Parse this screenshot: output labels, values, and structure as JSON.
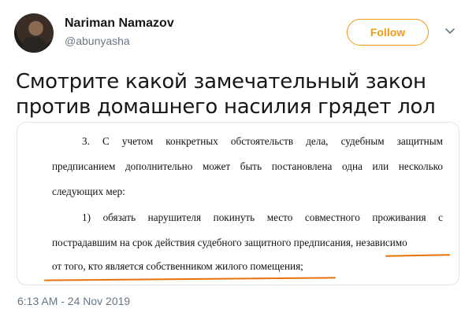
{
  "user": {
    "name": "Nariman Namazov",
    "handle": "@abunyasha"
  },
  "follow_button": {
    "label": "Follow",
    "color": "#f29a16"
  },
  "tweet": {
    "text": "Смотрите какой замечательный закон против домашнего насилия грядет лол",
    "timestamp": "6:13 AM - 24 Nov 2019"
  },
  "document": {
    "line1": [
      "3.",
      "С",
      "учетом",
      "конкретных",
      "обстоятельств",
      "дела,",
      "судебным",
      "защитным"
    ],
    "line2": [
      "предписанием",
      "дополнительно",
      "может",
      "быть",
      "постановлена",
      "одна",
      "или",
      "несколько"
    ],
    "line3": "следующих мер:",
    "line4": [
      "1)",
      "обязать",
      "нарушителя",
      "покинуть",
      "место",
      "совместного",
      "проживания",
      "с"
    ],
    "line5": "пострадавшим на срок действия судебного защитного предписания, независимо",
    "line6": "от того, кто является собственником жилого помещения;"
  },
  "highlight_color": "#e8720c"
}
